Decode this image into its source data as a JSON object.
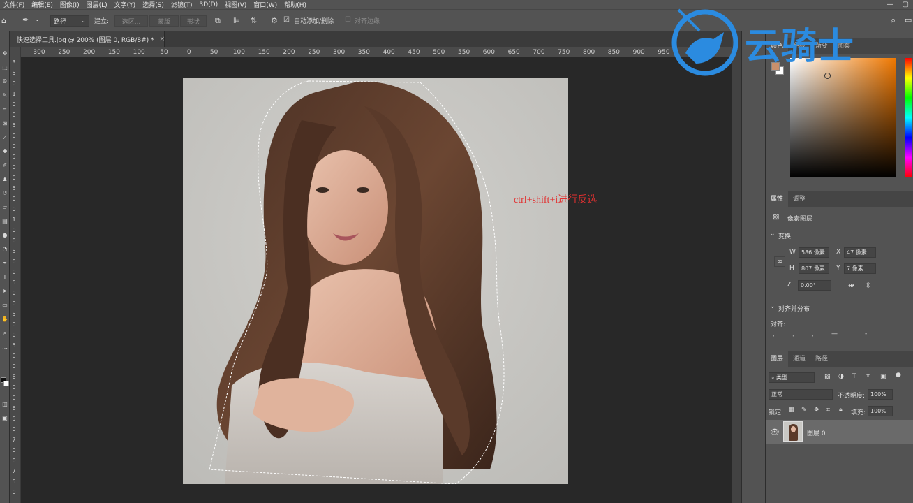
{
  "menu": [
    "文件(F)",
    "编辑(E)",
    "图像(I)",
    "图层(L)",
    "文字(Y)",
    "选择(S)",
    "滤镜(T)",
    "3D(D)",
    "视图(V)",
    "窗口(W)",
    "帮助(H)"
  ],
  "window_controls": [
    "—",
    "▢"
  ],
  "options": {
    "mode": "路径",
    "make_label": "建立:",
    "selection_btn": "选区...",
    "mask_btn": "蒙版",
    "shape_btn": "形状",
    "auto_add_delete": "自动添加/删除",
    "align_edges": "对齐边缘"
  },
  "document_tab": {
    "title": "快速选择工具.jpg @ 200% (图层 0, RGB/8#) *",
    "close": "×"
  },
  "ruler_h": [
    "300",
    "250",
    "200",
    "150",
    "100",
    "50",
    "0",
    "50",
    "100",
    "150",
    "200",
    "250",
    "300",
    "350",
    "400",
    "450",
    "500",
    "550",
    "600",
    "650",
    "700",
    "750",
    "800",
    "850",
    "900",
    "950"
  ],
  "ruler_v": [
    "3",
    "5",
    "0",
    "1",
    "0",
    "0",
    "5",
    "0",
    "0",
    "5",
    "0",
    "0",
    "5",
    "0",
    "0",
    "1",
    "0",
    "0",
    "5",
    "0",
    "0",
    "5",
    "0",
    "0",
    "5",
    "0",
    "0",
    "5",
    "0",
    "0",
    "6",
    "0",
    "0",
    "6",
    "5",
    "0",
    "7",
    "0",
    "0",
    "7",
    "5",
    "0"
  ],
  "annotation": "ctrl+shift+i进行反选",
  "color_panel": {
    "tabs": [
      "颜色",
      "色板",
      "渐变",
      "图案"
    ],
    "fg_color": "#c8906c",
    "bg_color": "#ffffff",
    "accent": "#f07800"
  },
  "properties": {
    "tabs": [
      "属性",
      "调整"
    ],
    "layer_type": "像素图层",
    "transform_title": "变换",
    "w_label": "W",
    "w_value": "586 像素",
    "x_label": "X",
    "x_value": "47 像素",
    "h_label": "H",
    "h_value": "807 像素",
    "y_label": "Y",
    "y_value": "7 像素",
    "angle_value": "0.00°",
    "align_title": "对齐并分布",
    "align_label": "对齐:"
  },
  "layers": {
    "tabs": [
      "图层",
      "通道",
      "路径"
    ],
    "filter_kind": "类型",
    "blend_mode": "正常",
    "opacity_label": "不透明度:",
    "opacity_value": "100%",
    "lock_label": "锁定:",
    "fill_label": "填充:",
    "fill_value": "100%",
    "layer_name": "图层 0"
  },
  "watermark_text": "云骑士"
}
